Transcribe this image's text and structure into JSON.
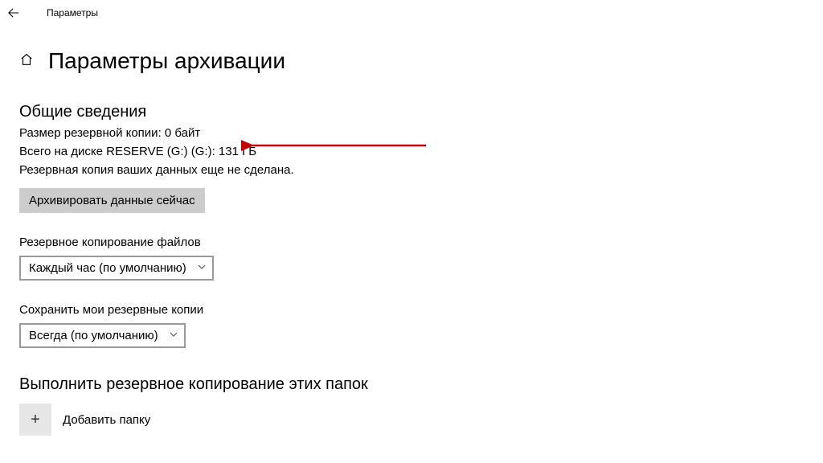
{
  "titleBar": {
    "appName": "Параметры"
  },
  "header": {
    "pageTitle": "Параметры архивации"
  },
  "overview": {
    "heading": "Общие сведения",
    "backupSize": "Размер резервной копии: 0 байт",
    "diskTotal": "Всего на диске RESERVE (G:) (G:): 131 ГБ",
    "notYet": "Резервная копия ваших данных еще не сделана.",
    "backupNowButton": "Архивировать данные сейчас"
  },
  "frequency": {
    "label": "Резервное копирование файлов",
    "value": "Каждый час (по умолчанию)"
  },
  "retention": {
    "label": "Сохранить мои резервные копии",
    "value": "Всегда (по умолчанию)"
  },
  "folders": {
    "heading": "Выполнить резервное копирование этих папок",
    "addLabel": "Добавить папку"
  }
}
